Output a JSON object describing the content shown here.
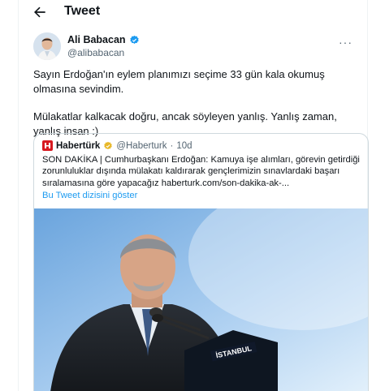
{
  "header": {
    "title": "Tweet"
  },
  "author": {
    "name": "Ali Babacan",
    "handle": "@alibabacan"
  },
  "tweet": {
    "paragraphs": [
      "Sayın Erdoğan'ın eylem planımızı seçime 33 gün kala okumuş olmasına sevindim.",
      "Mülakatlar kalkacak doğru, ancak söyleyen yanlış. Yanlış zaman, yanlış insan :)"
    ]
  },
  "quote": {
    "source_name": "Habertürk",
    "handle": "@Haberturk",
    "separator": "·",
    "time": "10d",
    "text": "SON DAKİKA | Cumhurbaşkanı Erdoğan: Kamuya işe alımları, görevin getirdiği zorunluluklar dışında mülakatı kaldırarak gençlerimizin sınavlardaki başarı sıralamasına göre yapacağız haberturk.com/son-dakika-ak-...",
    "show_thread": "Bu Tweet dizisini göster",
    "image_sign_text": "İSTANBUL"
  },
  "colors": {
    "link": "#1d9bf0",
    "verified": "#1d9bf0",
    "brand": "#d71920"
  },
  "icons": {
    "back": "arrow-left-icon",
    "verified": "verified-badge-icon",
    "more": "more-icon"
  }
}
